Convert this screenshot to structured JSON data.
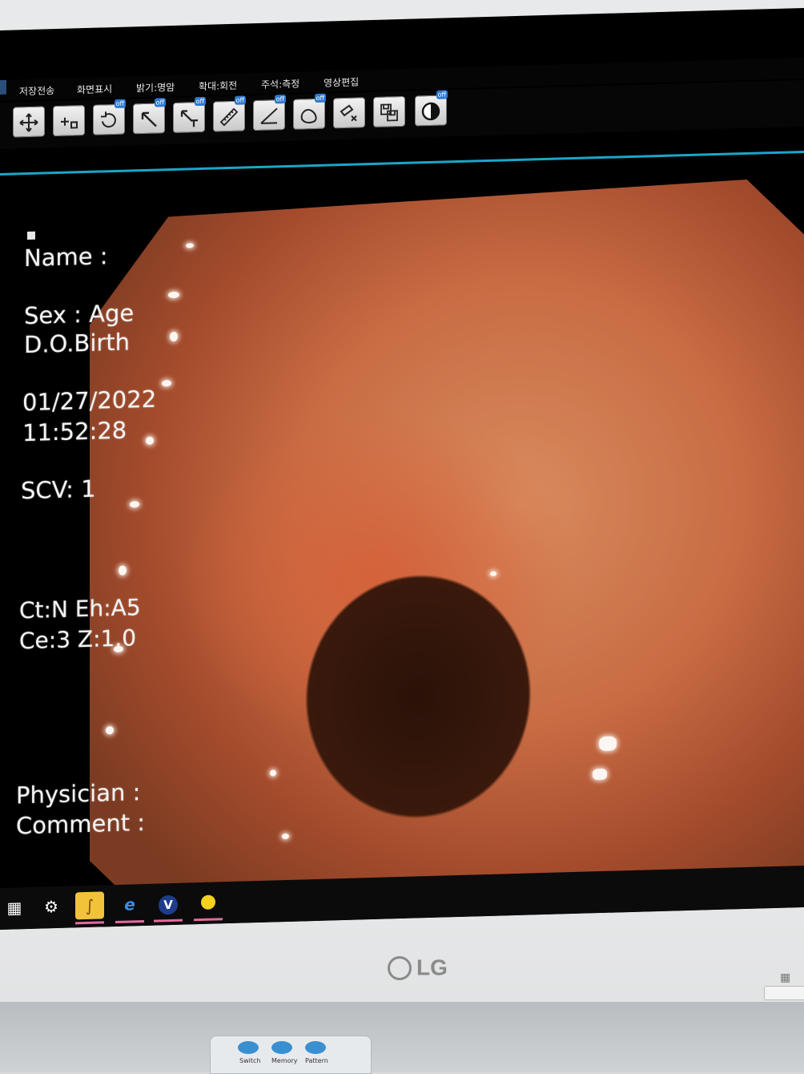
{
  "menu": {
    "items": [
      "저장전송",
      "화면표시",
      "밝기:명암",
      "확대:회전",
      "주석:측정",
      "영상편집"
    ]
  },
  "toolbar": {
    "tools": [
      {
        "name": "move-icon",
        "badge": ""
      },
      {
        "name": "pan-icon",
        "badge": ""
      },
      {
        "name": "rotate-icon",
        "badge": "off"
      },
      {
        "name": "arrow-icon",
        "badge": "off"
      },
      {
        "name": "arrow-text-icon",
        "badge": "off"
      },
      {
        "name": "ruler-icon",
        "badge": "off"
      },
      {
        "name": "angle-icon",
        "badge": "off"
      },
      {
        "name": "freehand-icon",
        "badge": "off"
      },
      {
        "name": "delete-measure-icon",
        "badge": ""
      },
      {
        "name": "save-icon",
        "badge": ""
      },
      {
        "name": "contrast-icon",
        "badge": "off"
      }
    ]
  },
  "overlay": {
    "name_label": "Name :",
    "sex_age": "Sex :  Age",
    "dob": "D.O.Birth",
    "date": "01/27/2022",
    "time": "11:52:28",
    "scv": "SCV: 1",
    "ct_eh": "Ct:N  Eh:A5",
    "ce_z": "Ce:3  Z:1.0",
    "physician": "Physician :",
    "comment": "Comment :"
  },
  "taskbar": {
    "icons": [
      "windows-start-icon",
      "app-robot-icon",
      "app-yellow-icon",
      "internet-explorer-icon",
      "viewer-v-icon",
      "yellow-dot-icon"
    ]
  },
  "monitor": {
    "brand": "LG"
  },
  "panel": {
    "labels": [
      "Switch",
      "Memory",
      "Pattern"
    ]
  },
  "colors": {
    "accent_line": "#1aa6c8",
    "taskbar_underline": "#e36b9e"
  }
}
